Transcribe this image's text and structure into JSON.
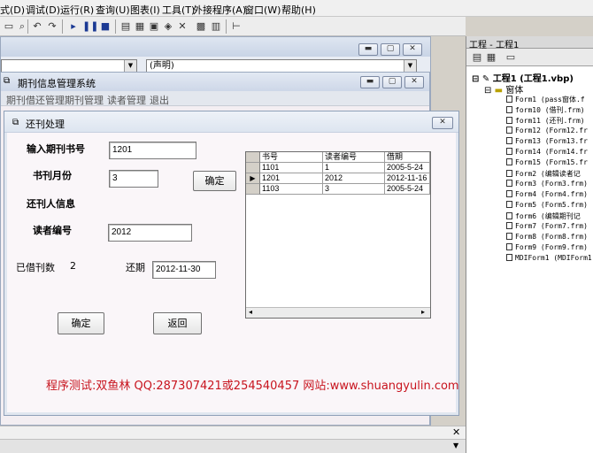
{
  "ide": {
    "menu": [
      "式(D)",
      "调试(D)",
      "运行(R)",
      "查询(U)",
      "图表(I)",
      "工具(T)",
      "外接程序(A)",
      "窗口(W)",
      "帮助(H)"
    ],
    "code_window": {
      "object_combo": "",
      "proc_combo": "(声明)"
    },
    "project": {
      "title": "工程 - 工程1",
      "root": "工程1 (工程1.vbp)",
      "folder": "窗体",
      "items": [
        "Form1 (pass窗体.f",
        "form10 (借刊.frm)",
        "form11 (还刊.frm)",
        "Form12 (Form12.fr",
        "Form13 (Form13.fr",
        "Form14 (Form14.fr",
        "Form15 (Form15.fr",
        "Form2 (编辑读者记",
        "Form3 (Form3.frm)",
        "Form4 (Form4.frm)",
        "Form5 (Form5.frm)",
        "form6 (编辑期刊记",
        "Form7 (Form7.frm)",
        "Form8 (Form8.frm)",
        "Form9 (Form9.frm)",
        "MDIForm1 (MDIForm1"
      ]
    }
  },
  "app": {
    "title": "期刊信息管理系统",
    "menu": [
      "期刊借还管理",
      "期刊管理",
      "读者管理",
      "退出"
    ]
  },
  "dialog": {
    "title": "还刊处理",
    "labels": {
      "journal_no": "输入期刊书号",
      "journal_month": "书刊月份",
      "return_person": "还刊人信息",
      "reader_no": "读者编号",
      "borrowed_count": "已借刊数",
      "due_date": "还期"
    },
    "values": {
      "journal_no": "1201",
      "journal_month": "3",
      "reader_no": "2012",
      "borrowed_count": "2",
      "due_date": "2012-11-30"
    },
    "buttons": {
      "confirm_top": "确定",
      "confirm": "确定",
      "back": "返回"
    },
    "grid": {
      "columns": [
        "书号",
        "读者编号",
        "借期"
      ],
      "rows": [
        [
          "1101",
          "1",
          "2005-5-24"
        ],
        [
          "1201",
          "2012",
          "2012-11-16"
        ],
        [
          "1103",
          "3",
          "2005-5-24"
        ]
      ],
      "selected_row": 1
    },
    "footer": "程序测试:双鱼林 QQ:287307421或254540457 网站:www.shuangyulin.com"
  }
}
